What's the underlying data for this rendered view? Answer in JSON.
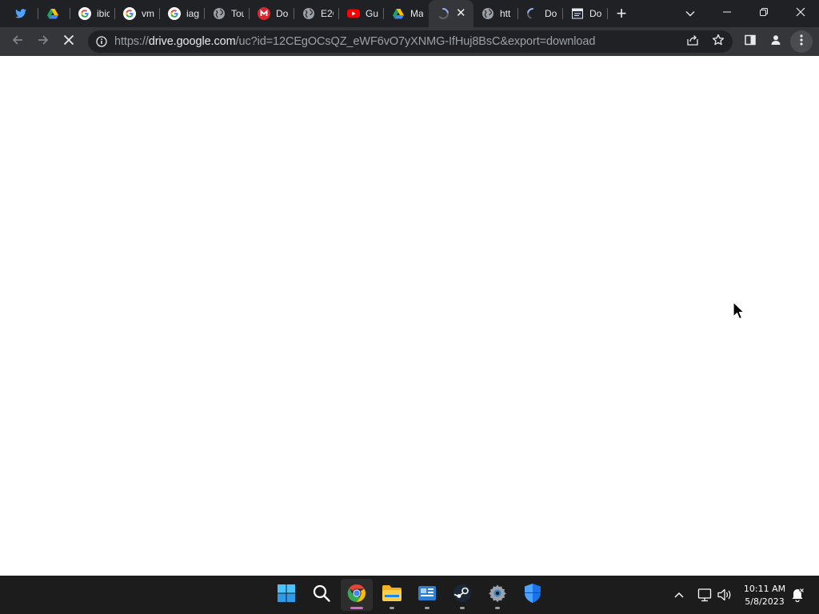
{
  "tabs": [
    {
      "icon": "twitter-icon",
      "title": ""
    },
    {
      "icon": "google-drive-icon",
      "title": ""
    },
    {
      "icon": "google-icon",
      "title": "ibic"
    },
    {
      "icon": "google-icon",
      "title": "vm"
    },
    {
      "icon": "google-icon",
      "title": "iag"
    },
    {
      "icon": "globe-icon",
      "title": "Tou"
    },
    {
      "icon": "mega-icon",
      "title": "Do"
    },
    {
      "icon": "globe-icon",
      "title": "E2C"
    },
    {
      "icon": "youtube-icon",
      "title": "Gu"
    },
    {
      "icon": "google-drive-icon",
      "title": "Ma"
    },
    {
      "icon": "loading-spinner-icon",
      "title": "",
      "active": true
    },
    {
      "icon": "globe-icon",
      "title": "htt"
    },
    {
      "icon": "loading-spinner-icon",
      "title": "Do"
    },
    {
      "icon": "notepad-icon",
      "title": "Do"
    }
  ],
  "tab_close_glyph": "✕",
  "new_tab_glyph": "+",
  "address_bar": {
    "scheme": "https://",
    "host": "drive.google.com",
    "path": "/uc?id=12CEgOCsQZ_eWF6vO7yXNMG-IfHuj8BsC&export=download"
  },
  "page_state": "loading",
  "taskbar": {
    "apps": [
      "windows-start-icon",
      "search-icon",
      "chrome-icon",
      "file-explorer-icon",
      "app-icon",
      "steam-icon",
      "settings-icon",
      "windows-security-icon"
    ],
    "active_app": "chrome-icon"
  },
  "clock": {
    "time": "10:11 AM",
    "date": "5/8/2023"
  },
  "colors": {
    "tabstrip_bg": "#202124",
    "toolbar_bg": "#35363a",
    "omnibox_bg": "#202124",
    "taskbar_bg": "#1c1c1c",
    "active_indicator": "#d36cc3"
  }
}
